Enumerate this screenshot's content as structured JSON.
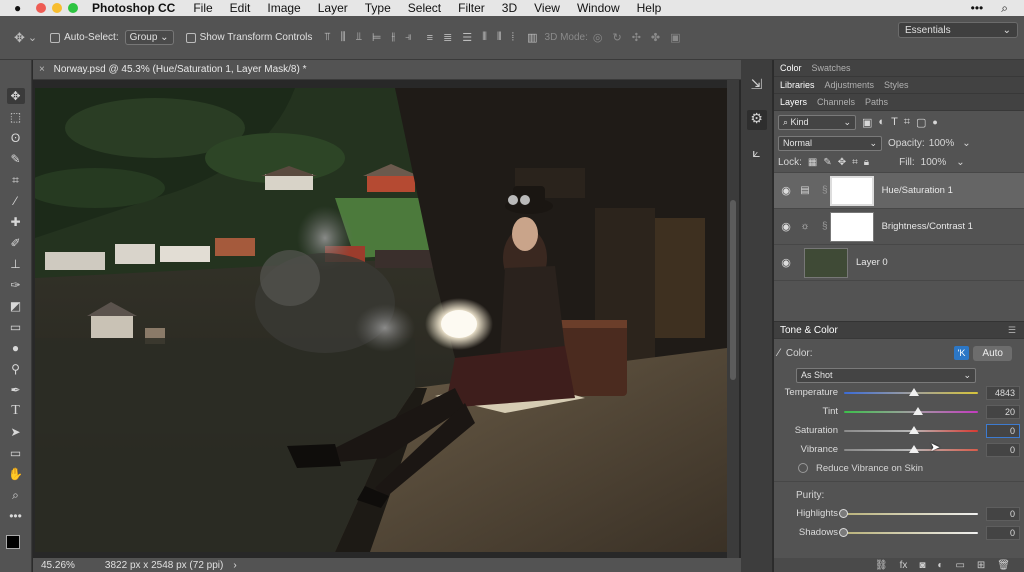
{
  "menubar": {
    "app": "Photoshop CC",
    "items": [
      "File",
      "Edit",
      "Image",
      "Layer",
      "Type",
      "Select",
      "Filter",
      "3D",
      "View",
      "Window",
      "Help"
    ],
    "right_icons": [
      "more-icon",
      "search-icon"
    ]
  },
  "options": {
    "auto_select_label": "Auto-Select:",
    "auto_select_value": "Group",
    "show_transform_label": "Show Transform Controls",
    "mode3d_label": "3D Mode:",
    "workspace": "Essentials"
  },
  "document": {
    "tab_title": "Norway.psd @ 45.3% (Hue/Saturation 1, Layer Mask/8) *",
    "zoom": "45.26%",
    "size": "3822 px x 2548 px (72 ppi)"
  },
  "panels": {
    "row1_tabs": [
      "Color",
      "Swatches"
    ],
    "row2_tabs": [
      "Libraries",
      "Adjustments",
      "Styles"
    ],
    "row3_tabs": [
      "Layers",
      "Channels",
      "Paths"
    ],
    "kind_label": "Kind",
    "blend_mode": "Normal",
    "opacity_label": "Opacity:",
    "opacity_value": "100%",
    "lock_label": "Lock:",
    "fill_label": "Fill:",
    "fill_value": "100%"
  },
  "layers": [
    {
      "name": "Hue/Saturation 1",
      "type": "hue-saturation-icon"
    },
    {
      "name": "Brightness/Contrast 1",
      "type": "brightness-icon"
    },
    {
      "name": "Layer 0",
      "type": "image"
    }
  ],
  "tone": {
    "title": "Tone & Color",
    "color_label": "Color:",
    "auto_label": "Auto",
    "k_label": "'K",
    "preset": "As Shot",
    "sliders": [
      {
        "label": "Temperature",
        "value": "4843",
        "pos": 0.52
      },
      {
        "label": "Tint",
        "value": "20",
        "pos": 0.55
      },
      {
        "label": "Saturation",
        "value": "0",
        "pos": 0.52
      },
      {
        "label": "Vibrance",
        "value": "0",
        "pos": 0.52
      }
    ],
    "reduce_vibrance_label": "Reduce Vibrance on Skin",
    "purity_label": "Purity:",
    "purity_sliders": [
      {
        "label": "Highlights",
        "value": "0",
        "pos": 0.0
      },
      {
        "label": "Shadows",
        "value": "0",
        "pos": 0.0
      }
    ]
  }
}
